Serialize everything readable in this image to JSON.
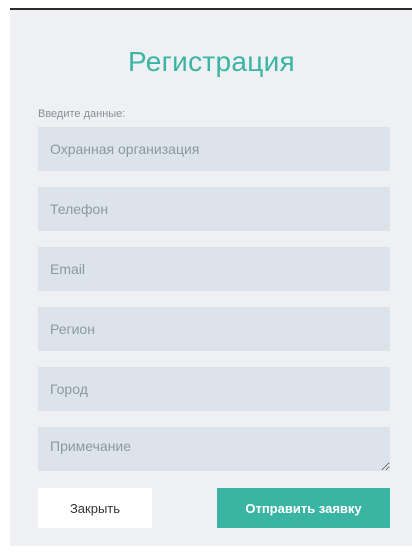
{
  "form": {
    "title": "Регистрация",
    "hint": "Введите данные:",
    "fields": {
      "organization": {
        "placeholder": "Охранная организация",
        "value": ""
      },
      "phone": {
        "placeholder": "Телефон",
        "value": ""
      },
      "email": {
        "placeholder": "Email",
        "value": ""
      },
      "region": {
        "placeholder": "Регион",
        "value": ""
      },
      "city": {
        "placeholder": "Город",
        "value": ""
      },
      "note": {
        "placeholder": "Примечание",
        "value": ""
      }
    },
    "buttons": {
      "close_label": "Закрыть",
      "submit_label": "Отправить заявку"
    }
  },
  "colors": {
    "accent": "#3ab5a4",
    "panel_bg": "#eef0f3",
    "field_bg": "#dde3ea"
  }
}
